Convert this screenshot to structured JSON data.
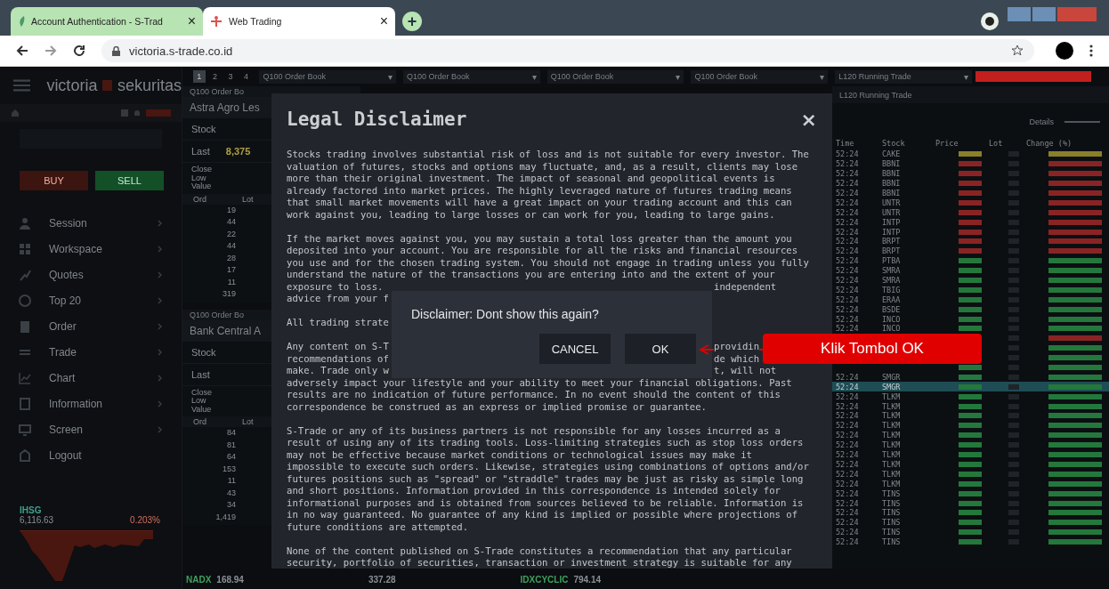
{
  "browser": {
    "tabs": [
      {
        "title": "Account Authentication - S-Trad",
        "close": "×",
        "selected": false
      },
      {
        "title": "Web Trading",
        "close": "×",
        "selected": true
      }
    ],
    "new_tab": "+",
    "url": "victoria.s-trade.co.id"
  },
  "sidebar": {
    "logo": [
      "victoria",
      "sekuritas"
    ],
    "buy": "BUY",
    "sell": "SELL",
    "menu": [
      {
        "kind": "session",
        "label": "Session",
        "submenu": true
      },
      {
        "kind": "workspace",
        "label": "Workspace",
        "submenu": true
      },
      {
        "kind": "quotes",
        "label": "Quotes",
        "submenu": true
      },
      {
        "kind": "top",
        "label": "Top 20",
        "submenu": true
      },
      {
        "kind": "order",
        "label": "Order",
        "submenu": true
      },
      {
        "kind": "trade",
        "label": "Trade",
        "submenu": true
      },
      {
        "kind": "chart",
        "label": "Chart",
        "submenu": true
      },
      {
        "kind": "info",
        "label": "Information",
        "submenu": true
      },
      {
        "kind": "screen",
        "label": "Screen",
        "submenu": true
      },
      {
        "kind": "logout",
        "label": "Logout",
        "submenu": false
      }
    ],
    "index": {
      "name": "IHSG",
      "value": "6,116.63",
      "change": "0.203%"
    }
  },
  "toolbar": {
    "pages": [
      {
        "label": "1",
        "selected": true
      },
      {
        "label": "2",
        "selected": false
      },
      {
        "label": "3",
        "selected": false
      },
      {
        "label": "4",
        "selected": false
      }
    ],
    "widgets": [
      {
        "label": "Q100 Order Book",
        "caret": "▾"
      },
      {
        "label": "Q100 Order Book",
        "caret": "▾"
      },
      {
        "label": "Q100 Order Book",
        "caret": "▾"
      },
      {
        "label": "Q100 Order Book",
        "caret": "▾"
      },
      {
        "label": "L120 Running Trade",
        "caret": "▾"
      }
    ]
  },
  "order_books": [
    {
      "title": "Q100 Order Bo",
      "stock_name": "Astra Agro Les",
      "stock_label": "Stock",
      "last_label": "Last",
      "last": "8,375",
      "stats": [
        "Close",
        "Low",
        "Value"
      ],
      "columns": [
        "Ord",
        "Lot"
      ],
      "ord": [
        "19",
        "44",
        "22",
        "44",
        "28",
        "17",
        "11",
        "319"
      ]
    },
    {
      "title": "Q100 Order Bo",
      "stock_name": "Bank Central A",
      "stock_label": "Stock",
      "last_label": "Last",
      "stats": [
        "Close",
        "Low",
        "Value"
      ],
      "columns": [
        "Ord",
        "Lot"
      ],
      "ord": [
        "84",
        "81",
        "64",
        "153",
        "11",
        "43",
        "34",
        "1,419"
      ]
    }
  ],
  "running_trade": {
    "title": "L120 Running Trade",
    "details": "Details",
    "columns": [
      "Time",
      "Stock",
      "Price",
      "Lot",
      "Change (%)"
    ],
    "rows": [
      {
        "time": "52:24",
        "stock": "CAKE",
        "color": "#8a7f2a",
        "selected": false
      },
      {
        "time": "52:24",
        "stock": "BBNI",
        "color": "#8a2424",
        "selected": false
      },
      {
        "time": "52:24",
        "stock": "BBNI",
        "color": "#8a2424",
        "selected": false
      },
      {
        "time": "52:24",
        "stock": "BBNI",
        "color": "#8a2424",
        "selected": false
      },
      {
        "time": "52:24",
        "stock": "BBNI",
        "color": "#8a2424",
        "selected": false
      },
      {
        "time": "52:24",
        "stock": "UNTR",
        "color": "#8a2424",
        "selected": false
      },
      {
        "time": "52:24",
        "stock": "UNTR",
        "color": "#8a2424",
        "selected": false
      },
      {
        "time": "52:24",
        "stock": "INTP",
        "color": "#8a2424",
        "selected": false
      },
      {
        "time": "52:24",
        "stock": "INTP",
        "color": "#8a2424",
        "selected": false
      },
      {
        "time": "52:24",
        "stock": "BRPT",
        "color": "#8a2424",
        "selected": false
      },
      {
        "time": "52:24",
        "stock": "BRPT",
        "color": "#8a2424",
        "selected": false
      },
      {
        "time": "52:24",
        "stock": "PTBA",
        "color": "#24783c",
        "selected": false
      },
      {
        "time": "52:24",
        "stock": "SMRA",
        "color": "#24783c",
        "selected": false
      },
      {
        "time": "52:24",
        "stock": "SMRA",
        "color": "#24783c",
        "selected": false
      },
      {
        "time": "52:24",
        "stock": "TBIG",
        "color": "#24783c",
        "selected": false
      },
      {
        "time": "52:24",
        "stock": "ERAA",
        "color": "#24783c",
        "selected": false
      },
      {
        "time": "52:24",
        "stock": "BSDE",
        "color": "#24783c",
        "selected": false
      },
      {
        "time": "52:24",
        "stock": "INCO",
        "color": "#24783c",
        "selected": false
      },
      {
        "time": "52:24",
        "stock": "INCO",
        "color": "#24783c",
        "selected": false
      },
      {
        "color": "#8a2424",
        "selected": false
      },
      {
        "color": "#24783c",
        "selected": false
      },
      {
        "color": "#24783c",
        "selected": false
      },
      {
        "color": "#24783c",
        "selected": false
      },
      {
        "time": "52:24",
        "stock": "SMGR",
        "color": "#24783c",
        "selected": false
      },
      {
        "time": "52:24",
        "stock": "SMGR",
        "color": "#24783c",
        "selected": true
      },
      {
        "time": "52:24",
        "stock": "TLKM",
        "color": "#24783c",
        "selected": false
      },
      {
        "time": "52:24",
        "stock": "TLKM",
        "color": "#24783c",
        "selected": false
      },
      {
        "time": "52:24",
        "stock": "TLKM",
        "color": "#24783c",
        "selected": false
      },
      {
        "time": "52:24",
        "stock": "TLKM",
        "color": "#24783c",
        "selected": false
      },
      {
        "time": "52:24",
        "stock": "TLKM",
        "color": "#24783c",
        "selected": false
      },
      {
        "time": "52:24",
        "stock": "TLKM",
        "color": "#24783c",
        "selected": false
      },
      {
        "time": "52:24",
        "stock": "TLKM",
        "color": "#24783c",
        "selected": false
      },
      {
        "time": "52:24",
        "stock": "TLKM",
        "color": "#24783c",
        "selected": false
      },
      {
        "time": "52:24",
        "stock": "TLKM",
        "color": "#24783c",
        "selected": false
      },
      {
        "time": "52:24",
        "stock": "TLKM",
        "color": "#24783c",
        "selected": false
      },
      {
        "time": "52:24",
        "stock": "TINS",
        "color": "#24783c",
        "selected": false
      },
      {
        "time": "52:24",
        "stock": "TINS",
        "color": "#24783c",
        "selected": false
      },
      {
        "time": "52:24",
        "stock": "TINS",
        "color": "#24783c",
        "selected": false
      },
      {
        "time": "52:24",
        "stock": "TINS",
        "color": "#24783c",
        "selected": false
      },
      {
        "time": "52:24",
        "stock": "TINS",
        "color": "#24783c",
        "selected": false
      },
      {
        "time": "52:24",
        "stock": "TINS",
        "color": "#24783c",
        "selected": false
      }
    ]
  },
  "ticker": [
    {
      "name": "NADX",
      "value": "168.94"
    },
    {
      "value": "337.28"
    },
    {
      "name": "IDXCYCLIC",
      "value": "794.14"
    }
  ],
  "disclaimer": {
    "title": "Legal Disclaimer",
    "close": "×",
    "paragraphs": [
      [
        {
          "text": "Stocks trading involves substantial risk of loss and is not suitable for every investor. The"
        },
        {
          "text": "valuation of futures, stocks and options may fluctuate, and, as a result, clients may lose"
        },
        {
          "text": "more than their original investment. The impact of seasonal and geopolitical events is"
        },
        {
          "text": "already factored into market prices. The highly leveraged nature of futures trading means"
        },
        {
          "text": "that small market movements will have a great impact on your trading account and this can"
        },
        {
          "text": "work against you, leading to large losses or can work for you, leading to large gains."
        }
      ],
      [
        {
          "text": "If the market moves against you, you may sustain a total loss greater than the amount you"
        },
        {
          "text": "deposited into your account. You are responsible for all the risks and financial resources"
        },
        {
          "text": "you use and for the chosen trading system. You should not engage in trading unless you fully"
        },
        {
          "text": "understand the nature of the transactions you are entering into and the extent of your"
        },
        {
          "text": "exposure to loss.",
          "right": "independent"
        },
        {
          "text": "advice from your f"
        }
      ],
      [
        {
          "text": "All trading strate"
        }
      ],
      [
        {
          "text": "Any content on S-T",
          "right": "providin"
        },
        {
          "text": "recommendations of",
          "right": "de which"
        },
        {
          "text": "make. Trade only w",
          "right": "t, will not"
        },
        {
          "text": "adversely impact your lifestyle and your ability to meet your financial obligations. Past"
        },
        {
          "text": "results are no indication of future performance. In no event should the content of this"
        },
        {
          "text": "correspondence be construed as an express or implied promise or guarantee."
        }
      ],
      [
        {
          "text": "S-Trade or any of its business partners is not responsible for any losses incurred as a"
        },
        {
          "text": "result of using any of its trading tools. Loss-limiting strategies such as stop loss orders"
        },
        {
          "text": "may not be effective because market conditions or technological issues may make it"
        },
        {
          "text": "impossible to execute such orders. Likewise, strategies using combinations of options and/or"
        },
        {
          "text": "futures positions such as \"spread\" or \"straddle\" trades may be just as risky as simple long"
        },
        {
          "text": "and short positions. Information provided in this correspondence is intended solely for"
        },
        {
          "text": "informational purposes and is obtained from sources believed to be reliable. Information is"
        },
        {
          "text": "in no way guaranteed. No guarantee of any kind is implied or possible where projections of"
        },
        {
          "text": "future conditions are attempted."
        }
      ],
      [
        {
          "text": "None of the content published on S-Trade constitutes a recommendation that any particular"
        },
        {
          "text": "security, portfolio of securities, transaction or investment strategy is suitable for any"
        }
      ]
    ]
  },
  "confirm": {
    "question": "Disclaimer: Dont show this again?",
    "buttons": [
      "CANCEL",
      "OK"
    ]
  },
  "callout": {
    "text": "Klik Tombol OK"
  }
}
